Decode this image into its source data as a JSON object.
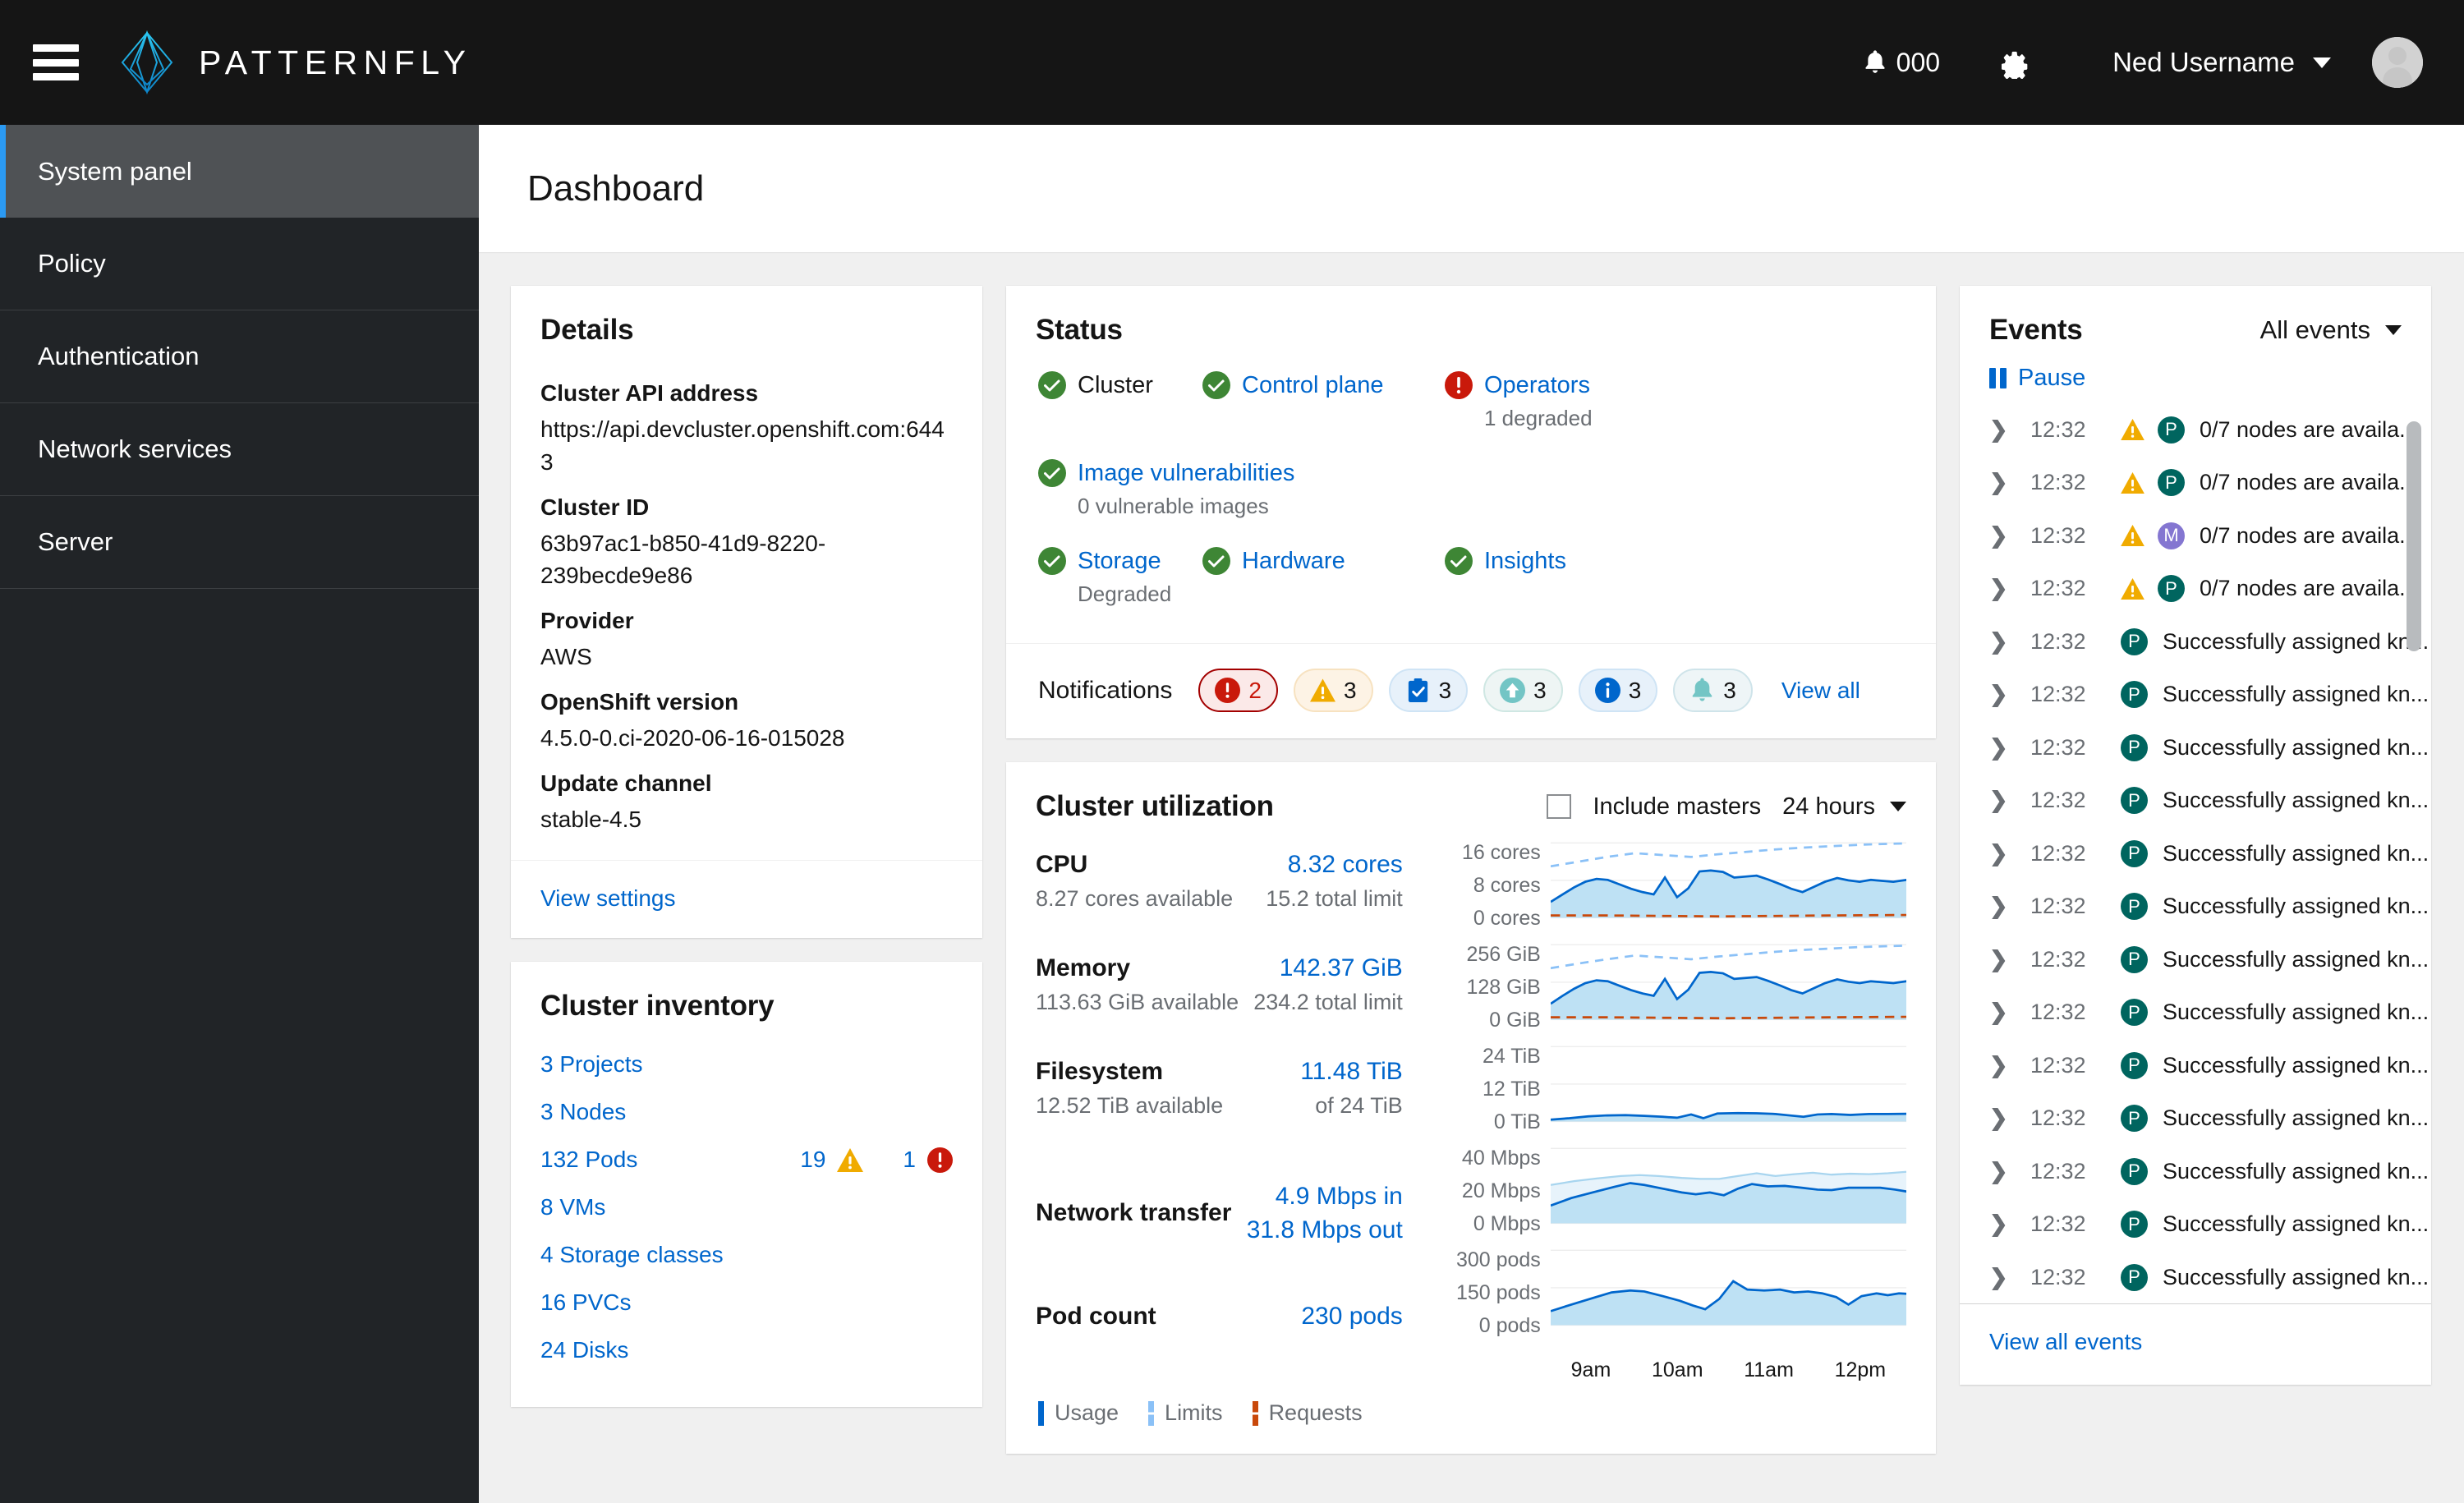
{
  "masthead": {
    "hamburger_icon": "hamburger-menu-icon",
    "brand_name": "PATTERNFLY",
    "notification_icon": "bell-icon",
    "notification_count": "000",
    "settings_icon": "gear-icon",
    "user_name": "Ned Username",
    "user_caret_icon": "chevron-down-icon",
    "avatar_icon": "user-avatar-icon"
  },
  "sidebar": {
    "items": [
      {
        "label": "System panel",
        "active": true
      },
      {
        "label": "Policy",
        "active": false
      },
      {
        "label": "Authentication",
        "active": false
      },
      {
        "label": "Network services",
        "active": false
      },
      {
        "label": "Server",
        "active": false
      }
    ]
  },
  "page": {
    "title": "Dashboard"
  },
  "details": {
    "title": "Details",
    "fields": [
      {
        "label": "Cluster API address",
        "value": "https://api.devcluster.openshift.com:6443"
      },
      {
        "label": "Cluster ID",
        "value": "63b97ac1-b850-41d9-8220-239becde9e86"
      },
      {
        "label": "Provider",
        "value": "AWS"
      },
      {
        "label": "OpenShift version",
        "value": "4.5.0-0.ci-2020-06-16-015028"
      },
      {
        "label": "Update channel",
        "value": "stable-4.5"
      }
    ],
    "footer_link": "View settings"
  },
  "inventory": {
    "title": "Cluster inventory",
    "rows": [
      {
        "label": "3 Projects",
        "warn": null,
        "err": null
      },
      {
        "label": "3 Nodes",
        "warn": null,
        "err": null
      },
      {
        "label": "132 Pods",
        "warn": "19",
        "err": "1"
      },
      {
        "label": "8 VMs",
        "warn": null,
        "err": null
      },
      {
        "label": "4 Storage classes",
        "warn": null,
        "err": null
      },
      {
        "label": "16 PVCs",
        "warn": null,
        "err": null
      },
      {
        "label": "24 Disks",
        "warn": null,
        "err": null
      }
    ]
  },
  "status": {
    "title": "Status",
    "items": [
      {
        "name": "Cluster",
        "icon": "check-circle-icon",
        "state": "ok",
        "sub": "",
        "link": false
      },
      {
        "name": "Control plane",
        "icon": "check-circle-icon",
        "state": "ok",
        "sub": "",
        "link": true
      },
      {
        "name": "Operators",
        "icon": "error-circle-icon",
        "state": "error",
        "sub": "1 degraded",
        "link": true
      },
      {
        "name": "Image vulnerabilities",
        "icon": "check-circle-icon",
        "state": "ok",
        "sub": "0 vulnerable images",
        "link": true
      },
      {
        "name": "Storage",
        "icon": "check-circle-icon",
        "state": "ok",
        "sub": "Degraded",
        "link": true
      },
      {
        "name": "Hardware",
        "icon": "check-circle-icon",
        "state": "ok",
        "sub": "",
        "link": true
      },
      {
        "name": "Insights",
        "icon": "check-circle-icon",
        "state": "ok",
        "sub": "",
        "link": true
      }
    ],
    "notifications_label": "Notifications",
    "chips": [
      {
        "icon": "error-circle-icon",
        "count": "2",
        "fill": "#fbe9e8",
        "border": "#a30000",
        "icon_color": "#c9190b"
      },
      {
        "icon": "warning-triangle-icon",
        "count": "3",
        "fill": "#fdf3e5",
        "border": "#f7e2c0",
        "icon_color": "#f0ab00"
      },
      {
        "icon": "clipboard-check-icon",
        "count": "3",
        "fill": "#e7f1fa",
        "border": "#cfe4f5",
        "icon_color": "#06c"
      },
      {
        "icon": "arrow-up-circle-icon",
        "count": "3",
        "fill": "#eef5f4",
        "border": "#cfe7e3",
        "icon_color": "#73c5c5"
      },
      {
        "icon": "info-circle-icon",
        "count": "3",
        "fill": "#e7f1fa",
        "border": "#cfe4f5",
        "icon_color": "#06c"
      },
      {
        "icon": "bell-icon",
        "count": "3",
        "fill": "#eef5f7",
        "border": "#cfe4ea",
        "icon_color": "#73c5c5"
      }
    ],
    "view_all_label": "View all"
  },
  "utilization": {
    "title": "Cluster utilization",
    "include_masters_label": "Include masters",
    "include_masters_checked": false,
    "range_label": "24 hours",
    "range_caret_icon": "chevron-down-icon",
    "metrics": [
      {
        "name": "CPU",
        "value": "8.32 cores",
        "available": "8.27 cores available",
        "limit": "15.2 total limit",
        "stacked": false
      },
      {
        "name": "Memory",
        "value": "142.37 GiB",
        "available": "113.63 GiB available",
        "limit": "234.2 total limit",
        "stacked": false
      },
      {
        "name": "Filesystem",
        "value": "11.48 TiB",
        "available": "12.52 TiB available",
        "limit": "of 24 TiB",
        "stacked": false
      },
      {
        "name": "Network transfer",
        "value": "4.9 Mbps in",
        "value2": "31.8 Mbps out",
        "available": "",
        "limit": "",
        "stacked": true
      },
      {
        "name": "Pod count",
        "value": "230 pods",
        "available": "",
        "limit": "",
        "stacked": true
      }
    ],
    "legend": [
      {
        "label": "Usage",
        "color": "#06c",
        "style": "solid"
      },
      {
        "label": "Limits",
        "color": "#8bc1f7",
        "style": "dashed"
      },
      {
        "label": "Requests",
        "color": "#c9490b",
        "style": "dashed"
      }
    ],
    "x_ticks": [
      "9am",
      "10am",
      "11am",
      "12pm"
    ]
  },
  "chart_data": [
    {
      "type": "area",
      "title": "CPU",
      "ylabel": "cores",
      "ytick_labels": [
        "16 cores",
        "8 cores",
        "0 cores"
      ],
      "ylim": [
        0,
        16
      ],
      "xlabel": "",
      "x": [
        "9am",
        "10am",
        "11am",
        "12pm"
      ],
      "grid": true,
      "legend": "none",
      "series": [
        {
          "name": "Usage",
          "style": "solid-area",
          "color": "#06c",
          "values": [
            3.4,
            5.1,
            6.7,
            7.9,
            8.5,
            8.3,
            7.3,
            6.4,
            5.7,
            5.2,
            8.6,
            4.4,
            6.3,
            9.9,
            10.1,
            9.8,
            8.6,
            8.8,
            9.0,
            8.2,
            7.2,
            6.2,
            5.5,
            6.6,
            7.8,
            8.7,
            8.2,
            7.9,
            8.3,
            8.1,
            7.9,
            8.3
          ]
        },
        {
          "name": "Limits",
          "style": "dashed",
          "color": "#8bc1f7",
          "values": [
            11.0,
            11.7,
            12.3,
            12.9,
            13.3,
            13.6,
            13.8,
            13.5,
            13.2,
            13.0,
            13.1,
            13.3,
            13.5,
            13.7,
            13.9,
            14.1,
            14.3,
            14.5,
            14.6,
            14.8,
            14.9,
            15.0,
            15.1,
            15.2,
            15.3,
            15.4,
            15.5,
            15.5,
            15.6,
            15.6,
            15.7,
            15.7
          ]
        },
        {
          "name": "Requests",
          "style": "dashed",
          "color": "#c9490b",
          "values": [
            0.45,
            0.45,
            0.45,
            0.45,
            0.45,
            0.42,
            0.42,
            0.4,
            0.4,
            0.38,
            0.38,
            0.36,
            0.36,
            0.35,
            0.35,
            0.35,
            0.36,
            0.36,
            0.38,
            0.38,
            0.4,
            0.4,
            0.42,
            0.42,
            0.44,
            0.44,
            0.46,
            0.46,
            0.48,
            0.48,
            0.5,
            0.5
          ]
        }
      ]
    },
    {
      "type": "area",
      "title": "Memory",
      "ylabel": "GiB",
      "ytick_labels": [
        "256 GiB",
        "128 GiB",
        "0 GiB"
      ],
      "ylim": [
        0,
        256
      ],
      "x": [
        "9am",
        "10am",
        "11am",
        "12pm"
      ],
      "grid": true,
      "series": [
        {
          "name": "Usage",
          "style": "solid-area",
          "color": "#06c",
          "values": [
            54,
            82,
            107,
            126,
            136,
            133,
            117,
            102,
            91,
            83,
            138,
            70,
            101,
            158,
            161,
            157,
            138,
            141,
            144,
            131,
            115,
            99,
            88,
            106,
            125,
            139,
            131,
            126,
            133,
            130,
            126,
            133
          ]
        },
        {
          "name": "Limits",
          "style": "dashed",
          "color": "#8bc1f7",
          "values": [
            176,
            187,
            197,
            206,
            213,
            218,
            221,
            216,
            211,
            208,
            210,
            213,
            216,
            219,
            222,
            226,
            229,
            232,
            234,
            237,
            238,
            240,
            242,
            243,
            245,
            246,
            248,
            248,
            250,
            250,
            251,
            251
          ]
        },
        {
          "name": "Requests",
          "style": "dashed",
          "color": "#c9490b",
          "values": [
            7,
            7,
            7,
            7,
            7,
            6.7,
            6.7,
            6.4,
            6.4,
            6,
            6,
            5.8,
            5.8,
            5.6,
            5.6,
            5.6,
            5.8,
            5.8,
            6,
            6,
            6.4,
            6.4,
            6.7,
            6.7,
            7,
            7,
            7.4,
            7.4,
            7.7,
            7.7,
            8,
            8
          ]
        }
      ]
    },
    {
      "type": "area",
      "title": "Filesystem",
      "ylabel": "TiB",
      "ytick_labels": [
        "24 TiB",
        "12 TiB",
        "0 TiB"
      ],
      "ylim": [
        0,
        24
      ],
      "x": [
        "9am",
        "10am",
        "11am",
        "12pm"
      ],
      "grid": true,
      "series": [
        {
          "name": "Usage",
          "style": "solid-area",
          "color": "#06c",
          "values": [
            0.5,
            0.9,
            1.3,
            1.5,
            1.6,
            1.5,
            1.4,
            1.3,
            1.2,
            1.1,
            1.7,
            1.0,
            1.4,
            1.9,
            1.9,
            1.9,
            1.8,
            1.8,
            1.8,
            1.7,
            1.5,
            1.3,
            1.2,
            1.5,
            1.7,
            1.8,
            1.7,
            1.7,
            1.8,
            1.7,
            1.7,
            1.8
          ]
        }
      ]
    },
    {
      "type": "area",
      "title": "Network transfer",
      "ylabel": "Mbps",
      "ytick_labels": [
        "40 Mbps",
        "20 Mbps",
        "0 Mbps"
      ],
      "ylim": [
        0,
        40
      ],
      "x": [
        "9am",
        "10am",
        "11am",
        "12pm"
      ],
      "grid": true,
      "series": [
        {
          "name": "In",
          "style": "solid-area",
          "color": "#06c",
          "values": [
            9.5,
            13.5,
            16.5,
            19.5,
            21.5,
            20.5,
            18.5,
            16.5,
            15.5,
            16.5,
            17.5,
            15.0,
            17.5,
            20.0,
            21.5,
            19.5,
            19.0,
            19.5,
            19.0,
            18.0,
            17.0,
            16.5,
            16.5,
            18.0,
            18.5,
            18.0,
            18.0,
            18.0,
            18.0,
            17.5,
            16.5,
            16.0
          ]
        },
        {
          "name": "Out",
          "style": "light-area",
          "color": "#bee1f4",
          "values": [
            20.5,
            22.5,
            24.0,
            25.5,
            26.5,
            26.0,
            25.0,
            24.5,
            24.5,
            25.5,
            27.0,
            25.5,
            26.5,
            27.5,
            28.0,
            27.0,
            27.5,
            27.5,
            27.0,
            25.5,
            26.0,
            25.5,
            24.5,
            26.5,
            27.0,
            26.0,
            26.5,
            26.0,
            27.0,
            26.5,
            26.5,
            27.5
          ]
        }
      ]
    },
    {
      "type": "area",
      "title": "Pod count",
      "ylabel": "pods",
      "ytick_labels": [
        "300 pods",
        "150 pods",
        "0 pods"
      ],
      "ylim": [
        0,
        300
      ],
      "x": [
        "9am",
        "10am",
        "11am",
        "12pm"
      ],
      "grid": true,
      "series": [
        {
          "name": "Pods",
          "style": "solid-area",
          "color": "#06c",
          "values": [
            58,
            82,
            105,
            122,
            133,
            130,
            116,
            101,
            89,
            77,
            108,
            137,
            171,
            150,
            149,
            150,
            148,
            138,
            142,
            141,
            130,
            116,
            100,
            118,
            134,
            130,
            123,
            129,
            133,
            128,
            128,
            133
          ]
        }
      ]
    }
  ],
  "events": {
    "title": "Events",
    "filter_label": "All events",
    "filter_caret_icon": "chevron-down-icon",
    "pause_label": "Pause",
    "pause_icon": "pause-icon",
    "footer_link": "View all events",
    "rows": [
      {
        "time": "12:32",
        "warn": true,
        "badge": "P",
        "badge_color": "#00655f",
        "msg": "0/7 nodes are availa..."
      },
      {
        "time": "12:32",
        "warn": true,
        "badge": "P",
        "badge_color": "#00655f",
        "msg": "0/7 nodes are availa..."
      },
      {
        "time": "12:32",
        "warn": true,
        "badge": "M",
        "badge_color": "#8476d1",
        "msg": "0/7 nodes are availa..."
      },
      {
        "time": "12:32",
        "warn": true,
        "badge": "P",
        "badge_color": "#00655f",
        "msg": "0/7 nodes are availa..."
      },
      {
        "time": "12:32",
        "warn": false,
        "badge": "P",
        "badge_color": "#00655f",
        "msg": "Successfully assigned kn..."
      },
      {
        "time": "12:32",
        "warn": false,
        "badge": "P",
        "badge_color": "#00655f",
        "msg": "Successfully assigned kn..."
      },
      {
        "time": "12:32",
        "warn": false,
        "badge": "P",
        "badge_color": "#00655f",
        "msg": "Successfully assigned kn..."
      },
      {
        "time": "12:32",
        "warn": false,
        "badge": "P",
        "badge_color": "#00655f",
        "msg": "Successfully assigned kn..."
      },
      {
        "time": "12:32",
        "warn": false,
        "badge": "P",
        "badge_color": "#00655f",
        "msg": "Successfully assigned kn..."
      },
      {
        "time": "12:32",
        "warn": false,
        "badge": "P",
        "badge_color": "#00655f",
        "msg": "Successfully assigned kn..."
      },
      {
        "time": "12:32",
        "warn": false,
        "badge": "P",
        "badge_color": "#00655f",
        "msg": "Successfully assigned kn..."
      },
      {
        "time": "12:32",
        "warn": false,
        "badge": "P",
        "badge_color": "#00655f",
        "msg": "Successfully assigned kn..."
      },
      {
        "time": "12:32",
        "warn": false,
        "badge": "P",
        "badge_color": "#00655f",
        "msg": "Successfully assigned kn..."
      },
      {
        "time": "12:32",
        "warn": false,
        "badge": "P",
        "badge_color": "#00655f",
        "msg": "Successfully assigned kn..."
      },
      {
        "time": "12:32",
        "warn": false,
        "badge": "P",
        "badge_color": "#00655f",
        "msg": "Successfully assigned kn..."
      },
      {
        "time": "12:32",
        "warn": false,
        "badge": "P",
        "badge_color": "#00655f",
        "msg": "Successfully assigned kn..."
      },
      {
        "time": "12:32",
        "warn": false,
        "badge": "P",
        "badge_color": "#00655f",
        "msg": "Successfully assigned kn..."
      }
    ]
  },
  "colors": {
    "accent_blue": "#06c",
    "brand_cyan": "#2bc5f0",
    "dark_bg": "#151515",
    "nav_bg": "#212427",
    "nav_active": "#4f5255",
    "nav_active_bar": "#2b9af3",
    "page_bg": "#f0f0f0",
    "ok_green": "#3e8635",
    "error_red": "#c9190b",
    "warn_yellow": "#f0ab00"
  }
}
